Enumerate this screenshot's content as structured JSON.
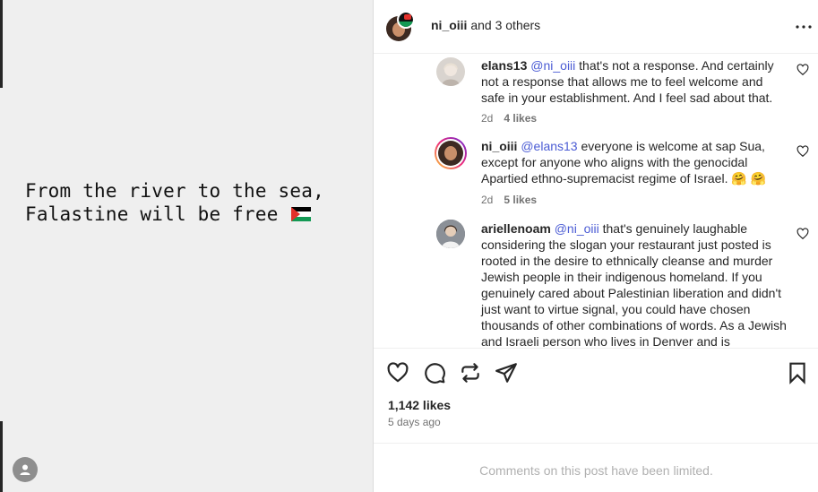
{
  "post": {
    "line1": "From the river to the sea,",
    "line2": "Falastine will be free",
    "flag_emoji": "palestine-flag"
  },
  "header": {
    "username": "ni_oiii",
    "others": " and 3 others"
  },
  "comments": [
    {
      "user": "elans13",
      "mention": "@ni_oiii",
      "text": " that's not a response. And certainly not a response that allows me to feel welcome and safe in your establishment. And I feel sad about that.",
      "age": "2d",
      "likes": "4 likes"
    },
    {
      "user": "ni_oiii",
      "mention": "@elans13",
      "text": " everyone is welcome at sap Sua, except for anyone who aligns with the genocidal Apartied ethno-supremacist regime of Israel. 🤗 🤗",
      "age": "2d",
      "likes": "5 likes"
    },
    {
      "user": "ariellenoam",
      "mention": "@ni_oiii",
      "text": " that's genuinely laughable considering the slogan your restaurant just posted is rooted in the desire to ethnically cleanse and murder Jewish people in their indigenous homeland. If you genuinely cared about Palestinian liberation and didn't just want to virtue signal, you could have chosen thousands of other combinations of words. As a Jewish and Israeli person who lives in Denver and is"
    }
  ],
  "stats": {
    "likes": "1,142 likes",
    "time_ago": "5 days ago"
  },
  "footer": {
    "limited": "Comments on this post have been limited."
  },
  "colors": {
    "mention": "#4a5bd4",
    "flag_red": "#e4312b",
    "flag_green": "#149954"
  }
}
